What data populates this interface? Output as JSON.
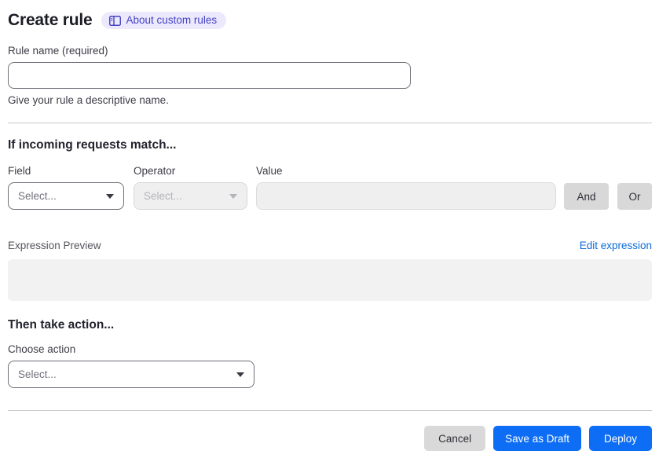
{
  "page": {
    "title": "Create rule",
    "about_link_label": "About custom rules"
  },
  "rule_name": {
    "label": "Rule name (required)",
    "value": "",
    "help": "Give your rule a descriptive name."
  },
  "match_section": {
    "heading": "If incoming requests match...",
    "field": {
      "label": "Field",
      "selected": "Select..."
    },
    "operator": {
      "label": "Operator",
      "selected": "Select..."
    },
    "value": {
      "label": "Value",
      "value": ""
    },
    "and_label": "And",
    "or_label": "Or",
    "expression_preview_label": "Expression Preview",
    "edit_expression_label": "Edit expression",
    "expression_value": ""
  },
  "action_section": {
    "heading": "Then take action...",
    "choose_action_label": "Choose action",
    "selected": "Select..."
  },
  "footer": {
    "cancel_label": "Cancel",
    "save_draft_label": "Save as Draft",
    "deploy_label": "Deploy"
  },
  "colors": {
    "primary_button_blue": "#0d6ef5",
    "link_blue": "#0d6dd8",
    "badge_background": "#ece9fd",
    "badge_text": "#4642c4",
    "disabled_field_bg": "#efefef",
    "gray_button_bg": "#d8d8d8",
    "preview_box_bg": "#f2f2f2"
  },
  "icons": {
    "docs_icon": "book-docs",
    "dropdown_caret": "chevron-down"
  }
}
